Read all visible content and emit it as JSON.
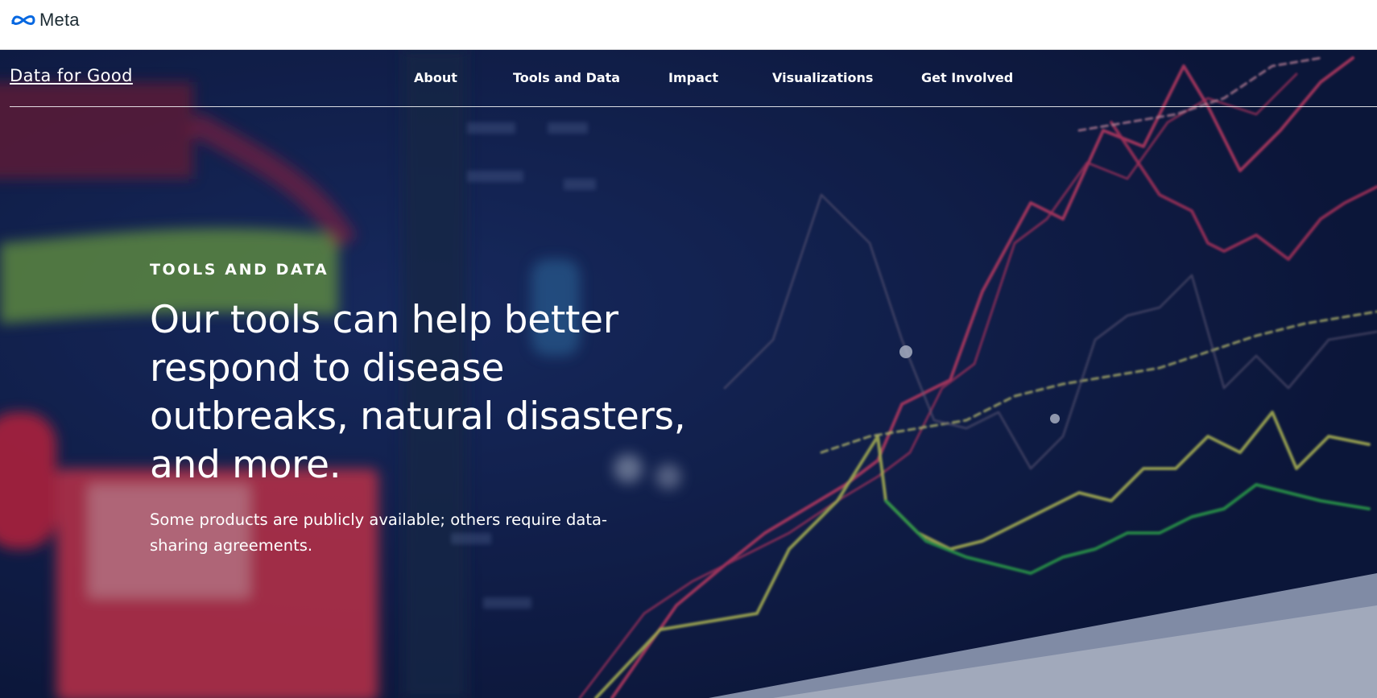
{
  "brand": {
    "logo_icon": "meta-infinity-icon",
    "name": "Meta"
  },
  "site": {
    "title": "Data for Good"
  },
  "nav": {
    "items": [
      {
        "label": "About"
      },
      {
        "label": "Tools and Data"
      },
      {
        "label": "Impact"
      },
      {
        "label": "Visualizations"
      },
      {
        "label": "Get Involved"
      }
    ]
  },
  "hero": {
    "eyebrow": "TOOLS AND DATA",
    "headline": "Our tools can help better respond to disease outbreaks, natural disasters, and more.",
    "subtext": "Some products are publicly available; others require data-sharing agreements.",
    "background": "stock-market-chart-photo"
  },
  "colors": {
    "hero_bg": "#0f1d46",
    "meta_blue": "#0668E1",
    "line_red": "#e8436a",
    "line_yellow": "#d8e05a",
    "line_green": "#35c24a"
  }
}
